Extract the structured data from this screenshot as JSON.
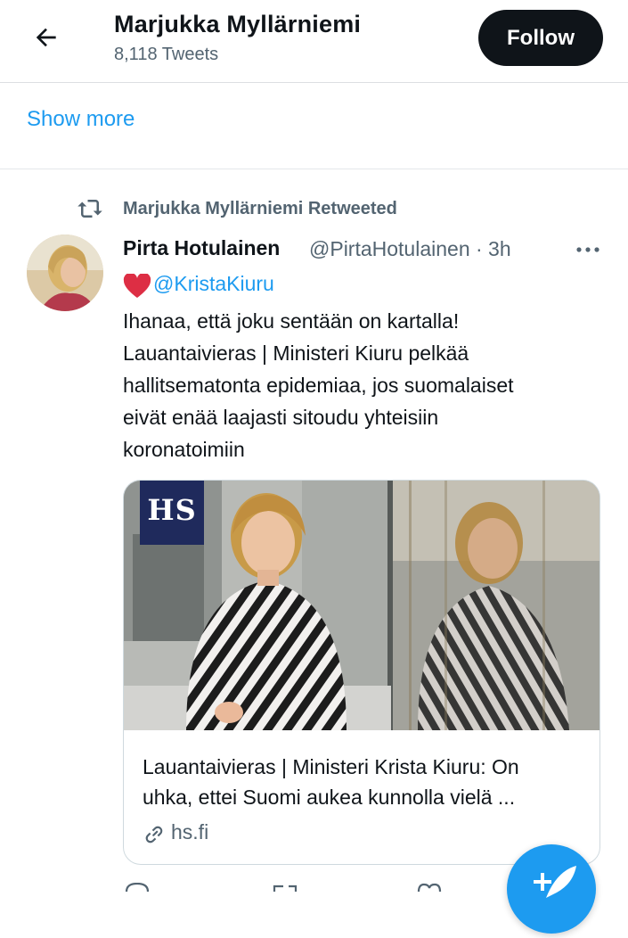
{
  "header": {
    "name": "Marjukka Myllärniemi",
    "tweet_count": "8,118 Tweets",
    "follow_label": "Follow"
  },
  "show_more": "Show more",
  "retweet": {
    "label": "Marjukka Myllärniemi Retweeted"
  },
  "tweet": {
    "author": "Pirta Hotulainen",
    "handle_time": "@PirtaHotulainen · 3h",
    "mention": "@KristaKiuru",
    "lines": [
      "Ihanaa, että joku sentään on kartalla!",
      "Lauantaivieras | Ministeri Kiuru pelkää",
      "hallitsematonta epidemiaa, jos suomalaiset",
      "eivät enää laajasti sitoudu yhteisiin",
      "koronatoimiin"
    ]
  },
  "card": {
    "logo_text": "HS",
    "title_lines": [
      "Lauantaivieras | Ministeri Krista Kiuru: On",
      "uhka, ettei Suomi aukea kunnolla vielä ..."
    ],
    "domain": "hs.fi"
  },
  "colors": {
    "accent": "#1d9bf0",
    "text": "#0f1419",
    "muted": "#536471",
    "heart": "#e0245e",
    "hs_logo_bg": "#1f2a5c"
  }
}
